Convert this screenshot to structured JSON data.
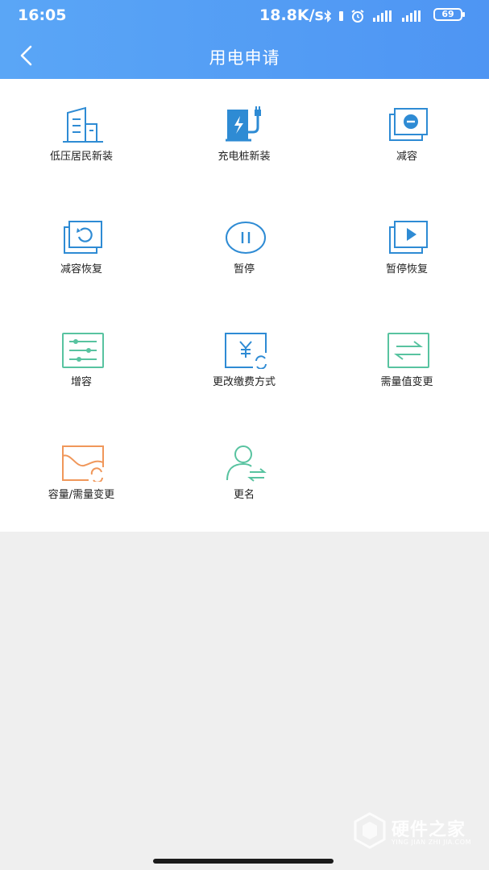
{
  "status_bar": {
    "time": "16:05",
    "network_speed": "18.8K/s",
    "battery": "69",
    "icons": [
      "bluetooth-icon",
      "vibrate-icon",
      "alarm-icon",
      "signal-icon",
      "signal-icon"
    ]
  },
  "header": {
    "title": "用电申请",
    "back_icon": "chevron-left-icon"
  },
  "colors": {
    "header_blue": "#4e95f3",
    "icon_blue": "#2e8bd4",
    "icon_green": "#58c3a0",
    "icon_orange": "#f0975a"
  },
  "services": [
    {
      "label": "低压居民新装",
      "icon": "building-icon"
    },
    {
      "label": "充电桩新装",
      "icon": "charging-pile-icon"
    },
    {
      "label": "减容",
      "icon": "capacity-reduce-icon"
    },
    {
      "label": "减容恢复",
      "icon": "capacity-restore-icon"
    },
    {
      "label": "暂停",
      "icon": "pause-icon"
    },
    {
      "label": "暂停恢复",
      "icon": "play-icon"
    },
    {
      "label": "增容",
      "icon": "sliders-icon"
    },
    {
      "label": "更改缴费方式",
      "icon": "yuan-refresh-icon"
    },
    {
      "label": "需量值变更",
      "icon": "swap-arrows-icon"
    },
    {
      "label": "容量/需量变更",
      "icon": "wave-refresh-icon"
    },
    {
      "label": "更名",
      "icon": "user-swap-icon"
    }
  ],
  "watermark": {
    "main": "硬件之家",
    "sub": "YING JIAN ZHI JIA.COM"
  }
}
